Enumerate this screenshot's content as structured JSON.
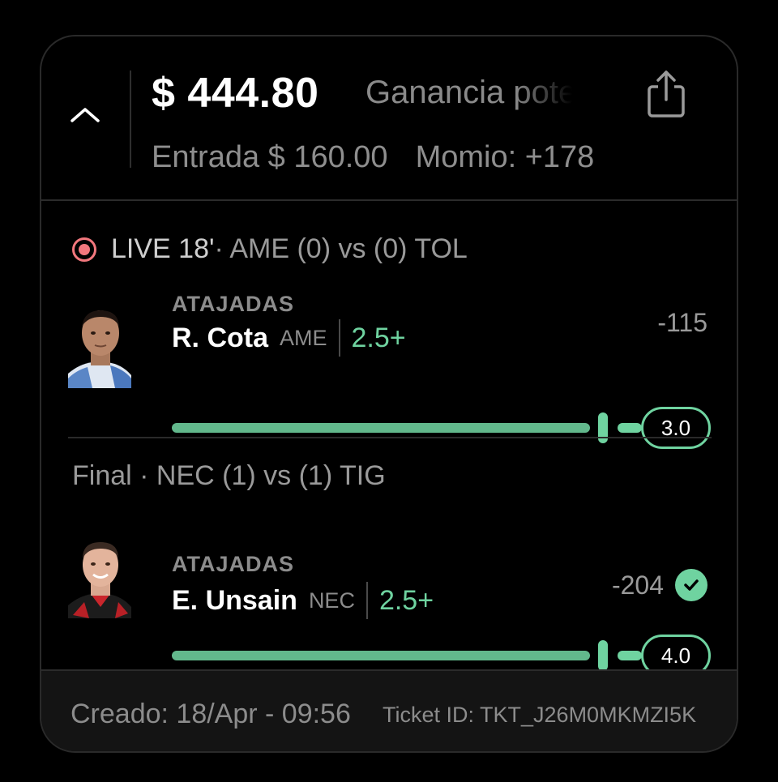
{
  "header": {
    "payout": "$ 444.80",
    "payout_label": "Ganancia potencial",
    "stake": "Entrada $ 160.00",
    "odds": "Momio: +178"
  },
  "legs": [
    {
      "status_live": "LIVE 18'",
      "status_rest": " · AME (0) vs (0) TOL",
      "market": "ATAJADAS",
      "player": "R. Cota",
      "team": "AME",
      "line": "2.5+",
      "odds": "-115",
      "current": "3.0",
      "progress": 1.0
    },
    {
      "status": "Final · NEC (1) vs (1) TIG",
      "market": "ATAJADAS",
      "player": "E. Unsain",
      "team": "NEC",
      "line": "2.5+",
      "odds": "-204",
      "current": "4.0",
      "progress": 1.0,
      "won": true
    }
  ],
  "footer": {
    "created": "Creado: 18/Apr - 09:56",
    "ticket_id": "Ticket ID: TKT_J26M0MKMZI5K"
  },
  "colors": {
    "accent_green": "#6fd3a0",
    "live_red": "#f2777d",
    "background": "#000000"
  },
  "icons": [
    "chevron-up-icon",
    "share-icon",
    "live-indicator-icon",
    "check-circle-icon"
  ]
}
